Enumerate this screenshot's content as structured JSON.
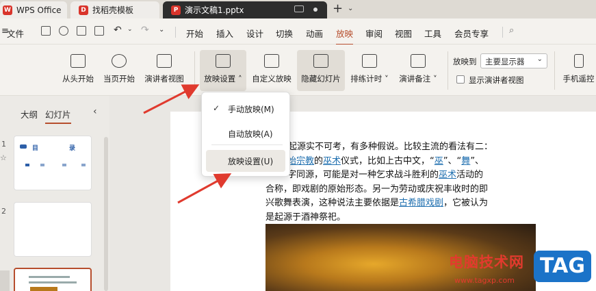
{
  "tabs": {
    "wps": "WPS Office",
    "template": "找稻壳模板",
    "document": "演示文稿1.pptx"
  },
  "menu": {
    "file": "文件",
    "items": [
      "开始",
      "插入",
      "设计",
      "切换",
      "动画",
      "放映",
      "审阅",
      "视图",
      "工具",
      "会员专享"
    ],
    "active": "放映"
  },
  "ribbon": {
    "from_start": "从头开始",
    "from_current": "当页开始",
    "presenter_view": "演讲者视图",
    "slideshow_settings": "放映设置",
    "custom_show": "自定义放映",
    "hide_slide": "隐藏幻灯片",
    "rehearse_timing": "排练计时",
    "speaker_notes": "演讲备注",
    "show_on_label": "放映到",
    "show_on_value": "主要显示器",
    "show_presenter_view": "显示演讲者视图",
    "phone_remote": "手机遥控"
  },
  "dropdown": {
    "manual": "手动放映(M)",
    "auto": "自动放映(A)",
    "settings": "放映设置(U)"
  },
  "leftpanel": {
    "tab_outline": "大纲",
    "tab_slides": "幻灯片",
    "slide_numbers": [
      "1",
      "2"
    ],
    "thumb1_title_a": "目",
    "thumb1_title_b": "录"
  },
  "slide_text": {
    "line1": "的起源实不可考，有多种假说。比较主流的看法有二：",
    "line2_a": "始宗教",
    "line2_b": "的",
    "line2_c": "巫术",
    "line2_d": "仪式，比如上古中文，“",
    "line2_e": "巫",
    "line2_f": "”、“",
    "line2_g": "舞",
    "line2_h": "”、",
    "line3_a": "字同源，可能是对一种乞求战斗胜利的",
    "line3_b": "巫术",
    "line3_c": "活动的",
    "line4": "合称，即戏剧的原始形态。另一为劳动或庆祝丰收时的即",
    "line5_a": "兴歌舞表演，这种说法主要依据是",
    "line5_b": "古希腊戏剧",
    "line5_c": "，它被认为",
    "line6": "是起源于酒神祭祀。"
  },
  "watermark": {
    "cn": "电脑技术网",
    "url": "www.tagxp.com",
    "badge": "TAG"
  }
}
